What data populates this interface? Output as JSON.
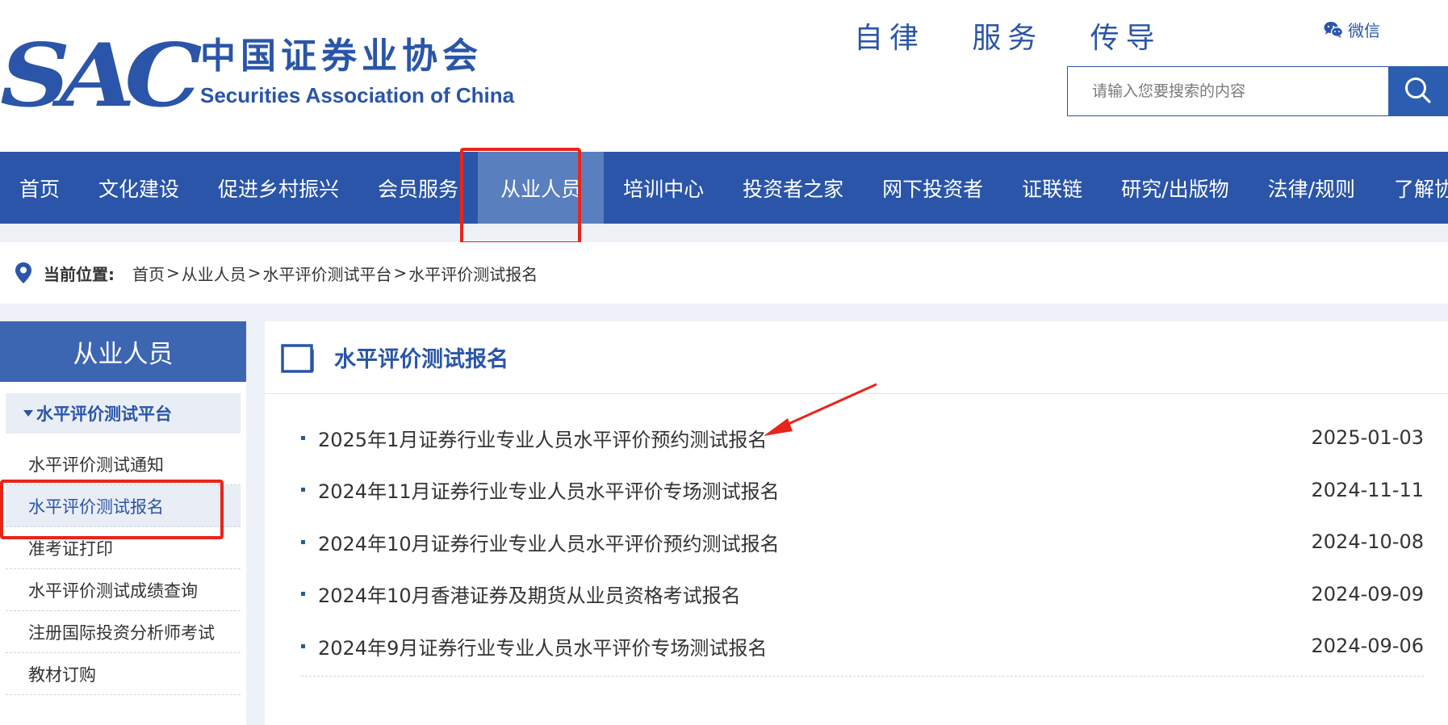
{
  "header": {
    "logo": {
      "mark": "SAC",
      "name_cn": "中国证券业协会",
      "name_en": "Securities Association of China"
    },
    "slogan": "自律   服务   传导",
    "wechat_label": "微信",
    "search": {
      "placeholder": "请输入您要搜索的内容"
    }
  },
  "nav": {
    "items": [
      "首页",
      "文化建设",
      "促进乡村振兴",
      "会员服务",
      "从业人员",
      "培训中心",
      "投资者之家",
      "网下投资者",
      "证联链",
      "研究/出版物",
      "法律/规则",
      "了解协会"
    ],
    "active": "从业人员"
  },
  "breadcrumb": {
    "label": "当前位置:",
    "items": [
      "首页",
      "从业人员",
      "水平评价测试平台",
      "水平评价测试报名"
    ],
    "separator": ">"
  },
  "sidebar": {
    "title": "从业人员",
    "group": "水平评价测试平台",
    "items": [
      "水平评价测试通知",
      "水平评价测试报名",
      "准考证打印",
      "水平评价测试成绩查询",
      "注册国际投资分析师考试",
      "教材订购"
    ],
    "active": "水平评价测试报名"
  },
  "main": {
    "title": "水平评价测试报名",
    "news": [
      {
        "title": "2025年1月证券行业专业人员水平评价预约测试报名",
        "date": "2025-01-03"
      },
      {
        "title": "2024年11月证券行业专业人员水平评价专场测试报名",
        "date": "2024-11-11"
      },
      {
        "title": "2024年10月证券行业专业人员水平评价预约测试报名",
        "date": "2024-10-08"
      },
      {
        "title": "2024年10月香港证券及期货从业员资格考试报名",
        "date": "2024-09-09"
      },
      {
        "title": "2024年9月证券行业专业人员水平评价专场测试报名",
        "date": "2024-09-06"
      }
    ]
  },
  "colors": {
    "brand": "#2a55a8",
    "nav_bg": "#2a55a8",
    "nav_active": "#5a7fbf",
    "annotation_red": "#e8251b",
    "page_bg": "#eef1f7"
  },
  "icons": {
    "wechat": "wechat-icon",
    "search": "search-icon",
    "location": "location-pin-icon",
    "section": "square-frame-icon",
    "group_caret": "caret-down-icon"
  }
}
